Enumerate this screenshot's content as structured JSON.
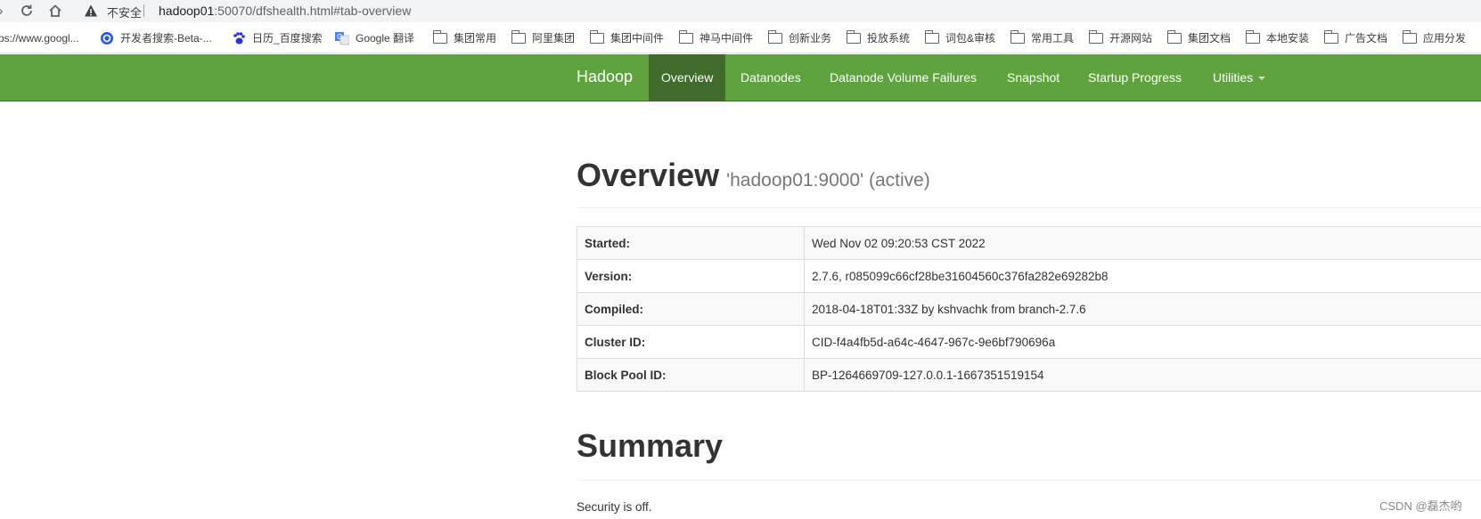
{
  "browser": {
    "insecure_label": "不安全",
    "url_host": "hadoop01",
    "url_rest": ":50070/dfshealth.html#tab-overview"
  },
  "bookmarks": [
    {
      "label": "ps://www.googl...",
      "icon": "none"
    },
    {
      "label": "开发者搜索-Beta-...",
      "icon": "dev-search-icon"
    },
    {
      "label": "日历_百度搜索",
      "icon": "baidu-paw-icon"
    },
    {
      "label": "Google 翻译",
      "icon": "google-translate-icon"
    },
    {
      "label": "集团常用",
      "icon": "folder-icon"
    },
    {
      "label": "阿里集团",
      "icon": "folder-icon"
    },
    {
      "label": "集团中间件",
      "icon": "folder-icon"
    },
    {
      "label": "神马中间件",
      "icon": "folder-icon"
    },
    {
      "label": "创新业务",
      "icon": "folder-icon"
    },
    {
      "label": "投放系统",
      "icon": "folder-icon"
    },
    {
      "label": "词包&审核",
      "icon": "folder-icon"
    },
    {
      "label": "常用工具",
      "icon": "folder-icon"
    },
    {
      "label": "开源网站",
      "icon": "folder-icon"
    },
    {
      "label": "集团文档",
      "icon": "folder-icon"
    },
    {
      "label": "本地安装",
      "icon": "folder-icon"
    },
    {
      "label": "广告文档",
      "icon": "folder-icon"
    },
    {
      "label": "应用分发",
      "icon": "folder-icon"
    }
  ],
  "navbar": {
    "brand": "Hadoop",
    "items": [
      {
        "label": "Overview",
        "active": true
      },
      {
        "label": "Datanodes"
      },
      {
        "label": "Datanode Volume Failures"
      },
      {
        "label": "Snapshot"
      },
      {
        "label": "Startup Progress"
      },
      {
        "label": "Utilities",
        "dropdown": true
      }
    ],
    "colors": {
      "bar": "#5fa33e",
      "active": "#3f6b2b"
    }
  },
  "overview": {
    "title": "Overview",
    "subtitle": "'hadoop01:9000' (active)",
    "rows": [
      {
        "key": "Started:",
        "value": "Wed Nov 02 09:20:53 CST 2022"
      },
      {
        "key": "Version:",
        "value": "2.7.6, r085099c66cf28be31604560c376fa282e69282b8"
      },
      {
        "key": "Compiled:",
        "value": "2018-04-18T01:33Z by kshvachk from branch-2.7.6"
      },
      {
        "key": "Cluster ID:",
        "value": "CID-f4a4fb5d-a64c-4647-967c-9e6bf790696a"
      },
      {
        "key": "Block Pool ID:",
        "value": "BP-1264669709-127.0.0.1-1667351519154"
      }
    ]
  },
  "summary": {
    "title": "Summary",
    "security_text": "Security is off."
  },
  "watermark": "CSDN @磊杰哟"
}
